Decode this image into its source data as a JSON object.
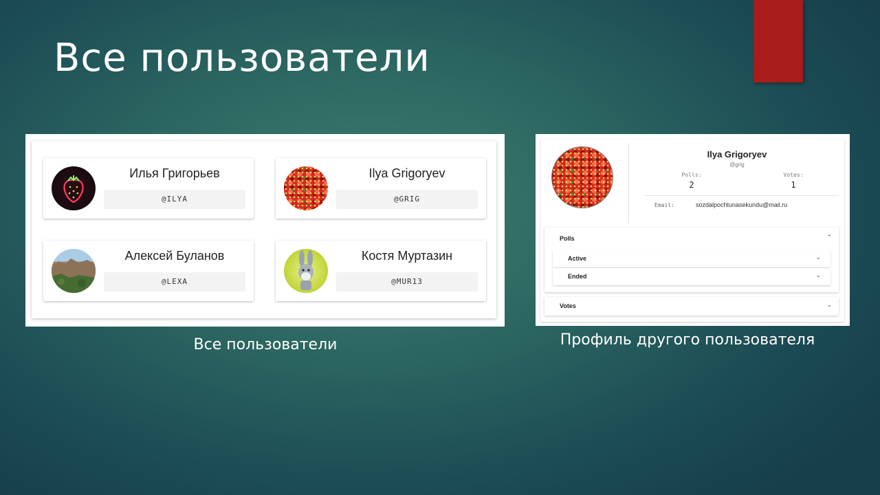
{
  "slide": {
    "title": "Все пользователи",
    "accent_color": "#a81c1c",
    "background_color": "#2c6661"
  },
  "users_view": {
    "caption": "Все пользователи",
    "users": [
      {
        "name": "Илья Григорьев",
        "handle": "@ILYA",
        "avatar": "neon-strawberry-avatar"
      },
      {
        "name": "Ilya Grigoryev",
        "handle": "@GRIG",
        "avatar": "strawberries-photo-avatar"
      },
      {
        "name": "Алексей Буланов",
        "handle": "@LEXA",
        "avatar": "landscape-photo-avatar"
      },
      {
        "name": "Костя Муртазин",
        "handle": "@MUR13",
        "avatar": "bunny-cartoon-avatar"
      }
    ]
  },
  "profile_view": {
    "caption": "Профиль другого пользователя",
    "name": "Ilya Grigoryev",
    "handle": "@grig",
    "stats": [
      {
        "label": "Polls:",
        "value": "2"
      },
      {
        "label": "Votes:",
        "value": "1"
      }
    ],
    "email_label": "Email:",
    "email": "sozdalpochtunasekundu@mail.ru",
    "sections": {
      "polls": {
        "label": "Polls",
        "expanded": true,
        "chevron": "chevron-up-icon"
      },
      "active": {
        "label": "Active",
        "chevron": "chevron-down-icon"
      },
      "ended": {
        "label": "Ended",
        "chevron": "chevron-down-icon"
      },
      "votes": {
        "label": "Votes",
        "chevron": "chevron-down-icon"
      }
    }
  }
}
